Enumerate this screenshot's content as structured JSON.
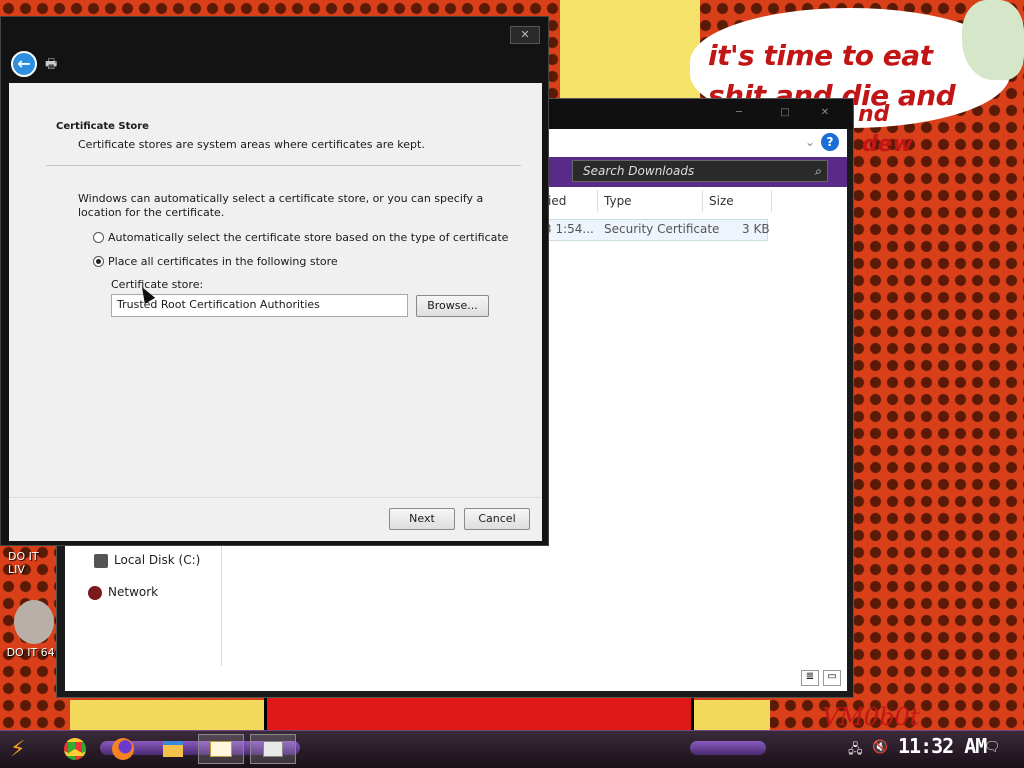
{
  "desktop": {
    "bubble_text": "it's time to eat shit and die and chew",
    "bubble_extra1": "nd",
    "bubble_extra2": "dew",
    "signature": "VM0b0t",
    "icons": [
      {
        "label": "DO IT LIV"
      },
      {
        "label": "DO IT 64 I"
      }
    ]
  },
  "explorer": {
    "search_placeholder": "Search Downloads",
    "columns": [
      "ied",
      "Type",
      "Size"
    ],
    "file": {
      "date": "3 1:54...",
      "type": "Security Certificate",
      "size": "3 KB"
    },
    "nav": [
      {
        "label": "Local Disk (C:)"
      },
      {
        "label": "Network"
      }
    ],
    "help": "?"
  },
  "dialog": {
    "close": "✕",
    "back": "←",
    "section_title": "Certificate Store",
    "section_subtitle": "Certificate stores are system areas where certificates are kept.",
    "intro": "Windows can automatically select a certificate store, or you can specify a location for the certificate.",
    "options": [
      {
        "label": "Automatically select the certificate store based on the type of certificate",
        "checked": false
      },
      {
        "label": "Place all certificates in the following store",
        "checked": true
      }
    ],
    "store_label": "Certificate store:",
    "store_value": "Trusted Root Certification Authorities",
    "browse": "Browse...",
    "next": "Next",
    "cancel": "Cancel"
  },
  "taskbar": {
    "clock": "11:32 AM",
    "apps": [
      {
        "icon": "chrome-icon"
      },
      {
        "icon": "firefox-icon"
      },
      {
        "icon": "file-explorer-icon"
      },
      {
        "icon": "certificate-icon"
      },
      {
        "icon": "certificate-wizard-icon"
      }
    ]
  },
  "colors": {
    "accent_purple": "#5a2a8a",
    "back_blue": "#2d8fe0",
    "bubble_red": "#c21515"
  }
}
